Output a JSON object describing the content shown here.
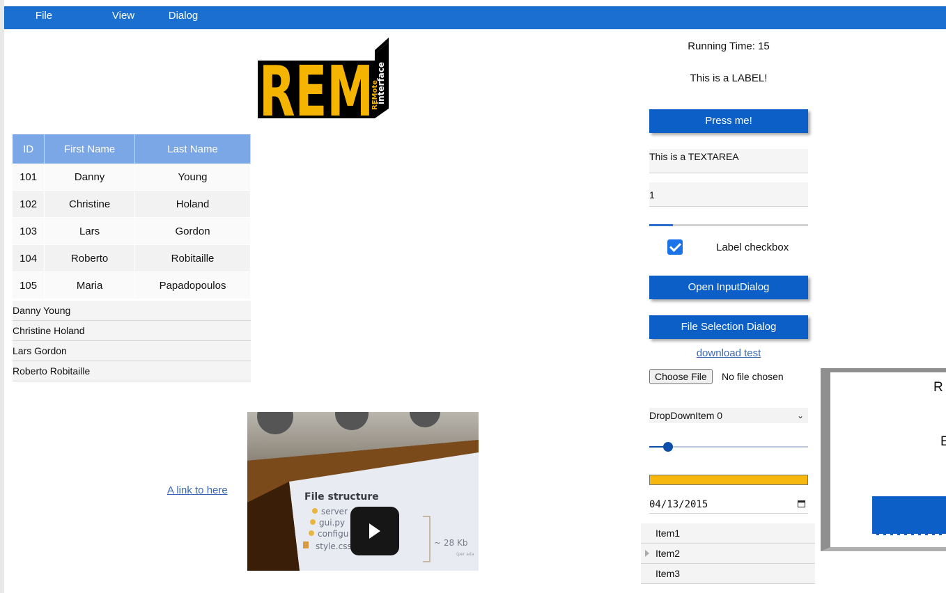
{
  "menu": {
    "items": [
      "File",
      "View",
      "Dialog"
    ]
  },
  "logo": {
    "letters": "REM",
    "side_top": "interface",
    "side_bottom": "REMote"
  },
  "table": {
    "headers": [
      "ID",
      "First Name",
      "Last Name"
    ],
    "rows": [
      [
        "101",
        "Danny",
        "Young"
      ],
      [
        "102",
        "Christine",
        "Holand"
      ],
      [
        "103",
        "Lars",
        "Gordon"
      ],
      [
        "104",
        "Roberto",
        "Robitaille"
      ],
      [
        "105",
        "Maria",
        "Papadopoulos"
      ]
    ]
  },
  "listview": {
    "items": [
      "Danny Young",
      "Christine Holand",
      "Lars Gordon",
      "Roberto Robitaille"
    ]
  },
  "link_here": "A link to here",
  "video": {
    "slide_title": "File structure",
    "slide_items": [
      "server",
      "gui.py",
      "configu",
      "style.css"
    ],
    "slide_size": "~ 28 Kb",
    "slide_note": "(per ada"
  },
  "right": {
    "running_time": "Running Time: 15",
    "label": "This is a LABEL!",
    "press_button": "Press me!",
    "textarea_value": "This is a TEXTAREA",
    "spin_value": "1",
    "progress": 0.15,
    "checkbox_checked": true,
    "checkbox_label": "Label checkbox",
    "input_dialog_button": "Open InputDialog",
    "file_dialog_button": "File Selection Dialog",
    "download_link": "download test",
    "choose_file_button": "Choose File",
    "no_file_text": "No file chosen",
    "dropdown_value": "DropDownItem 0",
    "slider_value": 0.12,
    "yellow_progress": 1.0,
    "date_value": "04/13/2015",
    "tree_items": [
      "Item1",
      "Item2",
      "Item3"
    ]
  },
  "dialog": {
    "text1": "R",
    "text2": "E"
  },
  "colors": {
    "menubar": "#1a6fd1",
    "button": "#0c5fc7",
    "table_header": "#7ba7e6",
    "progress_yellow": "#f6b80e"
  }
}
